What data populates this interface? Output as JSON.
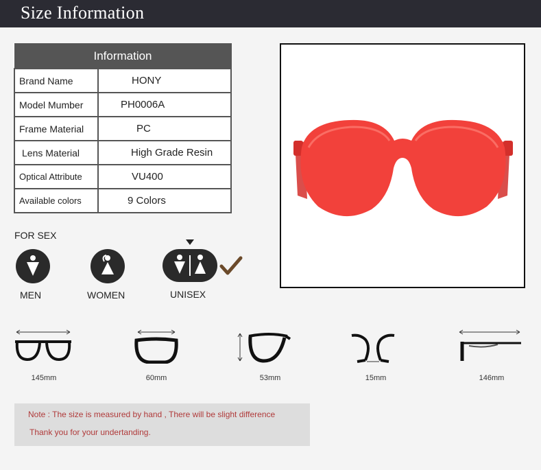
{
  "header": {
    "title": "Size Information"
  },
  "info_table": {
    "heading": "Information",
    "rows": [
      {
        "label": "Brand Name",
        "value": "HONY"
      },
      {
        "label": "Model Mumber",
        "value": "PH0006A"
      },
      {
        "label": "Frame Material",
        "value": "PC"
      },
      {
        "label": "Lens Material",
        "value": "High Grade Resin"
      },
      {
        "label": "Optical Attribute",
        "value": "VU400"
      },
      {
        "label": "Available colors",
        "value": "9 Colors"
      }
    ]
  },
  "sex": {
    "heading": "FOR SEX",
    "options": [
      "MEN",
      "WOMEN",
      "UNISEX"
    ],
    "selected": "UNISEX"
  },
  "product": {
    "lens_color": "#f2413b",
    "frame_color": "#d32f2b"
  },
  "dimensions": [
    {
      "icon": "frame-width-icon",
      "value": "145mm"
    },
    {
      "icon": "lens-width-icon",
      "value": "60mm"
    },
    {
      "icon": "lens-height-icon",
      "value": "53mm"
    },
    {
      "icon": "bridge-width-icon",
      "value": "15mm"
    },
    {
      "icon": "temple-length-icon",
      "value": "146mm"
    }
  ],
  "note": {
    "line1": "Note : The size is measured by hand , There will be slight difference",
    "line2": "Thank you for your undertanding."
  },
  "colors": {
    "header_bg": "#2b2b33",
    "table_border": "#555555",
    "note_text": "#b03a3a",
    "check": "#6b4a2a"
  }
}
